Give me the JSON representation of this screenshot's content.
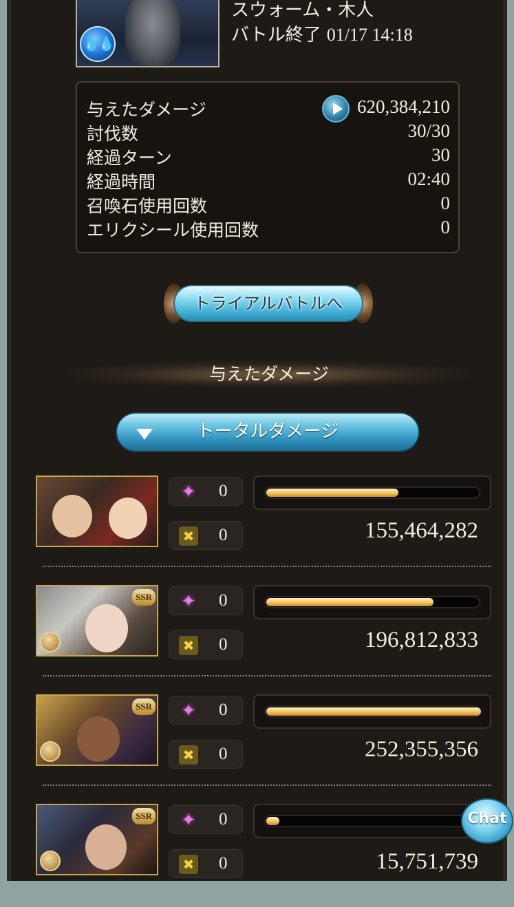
{
  "header": {
    "quest_name": "スウォーム・木人",
    "battle_end_label": "バトル終了",
    "timestamp": "01/17 14:18",
    "element_icon": "water-icon"
  },
  "stats": [
    {
      "label": "与えたダメージ",
      "value": "620,384,210"
    },
    {
      "label": "討伐数",
      "value": "30/30"
    },
    {
      "label": "経過ターン",
      "value": "30"
    },
    {
      "label": "経過時間",
      "value": "02:40"
    },
    {
      "label": "召喚石使用回数",
      "value": "0"
    },
    {
      "label": "エリクシール使用回数",
      "value": "0"
    }
  ],
  "trial_button_label": "トライアルバトルへ",
  "damage_section_title": "与えたダメージ",
  "total_damage_button_label": "トータルダメージ",
  "characters": [
    {
      "ssr": "",
      "ability_count": "0",
      "chain_count": "0",
      "damage": "155,464,282",
      "bar_fraction": 0.616
    },
    {
      "ssr": "SSR",
      "ability_count": "0",
      "chain_count": "0",
      "damage": "196,812,833",
      "bar_fraction": 0.78
    },
    {
      "ssr": "SSR",
      "ability_count": "0",
      "chain_count": "0",
      "damage": "252,355,356",
      "bar_fraction": 1.0
    },
    {
      "ssr": "SSR",
      "ability_count": "0",
      "chain_count": "0",
      "damage": "15,751,739",
      "bar_fraction": 0.062
    }
  ],
  "chat_button_label": "Chat",
  "colors": {
    "background": "#1e1a16",
    "bar_fill": "#f3c461",
    "accent_blue": "#49b4d8"
  }
}
